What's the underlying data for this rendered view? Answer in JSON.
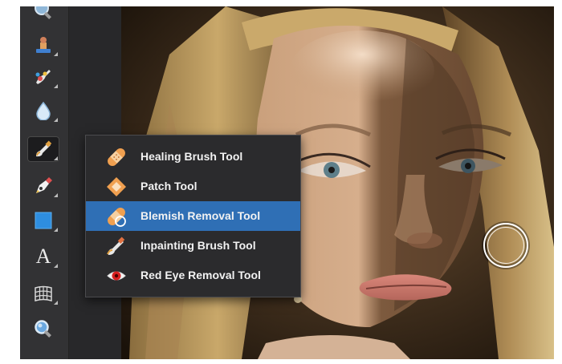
{
  "toolbar": {
    "tools": [
      {
        "name": "zoom-partial-icon"
      },
      {
        "name": "clone-stamp-icon"
      },
      {
        "name": "smudge-brush-icon"
      },
      {
        "name": "blur-drop-icon"
      },
      {
        "name": "healing-brush-group-icon",
        "active": true
      },
      {
        "name": "pen-tool-icon"
      },
      {
        "name": "rectangle-shape-icon"
      },
      {
        "name": "text-tool-glyph",
        "glyph": "A"
      },
      {
        "name": "mesh-warp-icon"
      },
      {
        "name": "magnifier-icon"
      }
    ]
  },
  "flyout_menu": {
    "items": [
      {
        "label": "Healing Brush Tool",
        "icon": "bandage-icon"
      },
      {
        "label": "Patch Tool",
        "icon": "patch-diamond-icon"
      },
      {
        "label": "Blemish Removal Tool",
        "icon": "blemish-bandage-icon",
        "selected": true
      },
      {
        "label": "Inpainting Brush Tool",
        "icon": "inpainting-brush-icon"
      },
      {
        "label": "Red Eye Removal Tool",
        "icon": "red-eye-icon"
      }
    ]
  },
  "colors": {
    "toolbar_bg": "#323234",
    "menu_bg": "#2b2b2d",
    "selected_bg": "#2f6fb5",
    "text": "#f2f2f2"
  }
}
